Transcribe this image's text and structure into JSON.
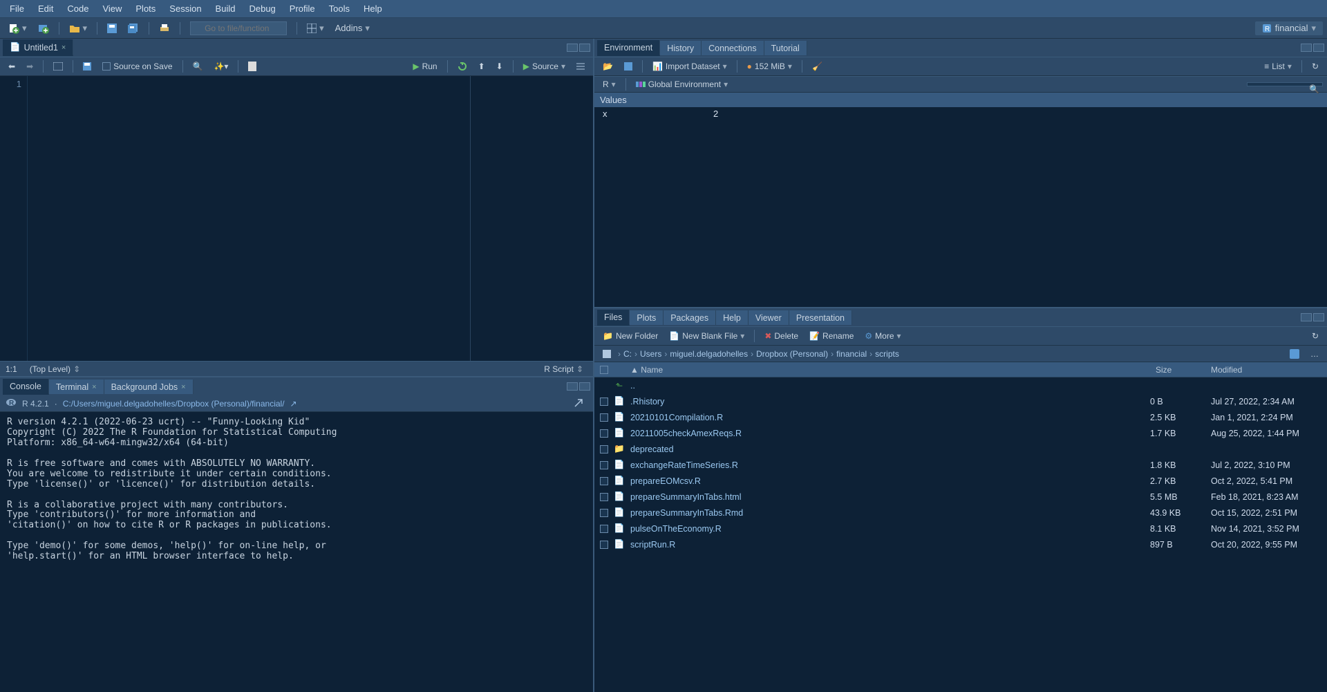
{
  "menu": [
    "File",
    "Edit",
    "Code",
    "View",
    "Plots",
    "Session",
    "Build",
    "Debug",
    "Profile",
    "Tools",
    "Help"
  ],
  "toolbar": {
    "goto_placeholder": "Go to file/function",
    "addins": "Addins",
    "project": "financial"
  },
  "source": {
    "tab": "Untitled1",
    "source_on_save": "Source on Save",
    "run": "Run",
    "source_btn": "Source",
    "line1": "1",
    "status_pos": "1:1",
    "status_scope": "(Top Level)",
    "status_lang": "R Script"
  },
  "console": {
    "tabs": [
      "Console",
      "Terminal",
      "Background Jobs"
    ],
    "r_version": "R 4.2.1",
    "wd": "C:/Users/miguel.delgadohelles/Dropbox (Personal)/financial/",
    "text": "R version 4.2.1 (2022-06-23 ucrt) -- \"Funny-Looking Kid\"\nCopyright (C) 2022 The R Foundation for Statistical Computing\nPlatform: x86_64-w64-mingw32/x64 (64-bit)\n\nR is free software and comes with ABSOLUTELY NO WARRANTY.\nYou are welcome to redistribute it under certain conditions.\nType 'license()' or 'licence()' for distribution details.\n\nR is a collaborative project with many contributors.\nType 'contributors()' for more information and\n'citation()' on how to cite R or R packages in publications.\n\nType 'demo()' for some demos, 'help()' for on-line help, or\n'help.start()' for an HTML browser interface to help."
  },
  "env": {
    "tabs": [
      "Environment",
      "History",
      "Connections",
      "Tutorial"
    ],
    "import": "Import Dataset",
    "mem": "152 MiB",
    "list": "List",
    "scope_lang": "R",
    "scope": "Global Environment",
    "section": "Values",
    "var_name": "x",
    "var_val": "2"
  },
  "files": {
    "tabs": [
      "Files",
      "Plots",
      "Packages",
      "Help",
      "Viewer",
      "Presentation"
    ],
    "new_folder": "New Folder",
    "new_file": "New Blank File",
    "delete": "Delete",
    "rename": "Rename",
    "more": "More",
    "crumbs": [
      "C:",
      "Users",
      "miguel.delgadohelles",
      "Dropbox (Personal)",
      "financial",
      "scripts"
    ],
    "col_name": "Name",
    "col_size": "Size",
    "col_mod": "Modified",
    "up": "..",
    "rows": [
      {
        "icon": "📄",
        "name": ".Rhistory",
        "size": "0 B",
        "mod": "Jul 27, 2022, 2:34 AM"
      },
      {
        "icon": "📄",
        "name": "20210101Compilation.R",
        "size": "2.5 KB",
        "mod": "Jan 1, 2021, 2:24 PM"
      },
      {
        "icon": "📄",
        "name": "20211005checkAmexReqs.R",
        "size": "1.7 KB",
        "mod": "Aug 25, 2022, 1:44 PM"
      },
      {
        "icon": "📁",
        "name": "deprecated",
        "size": "",
        "mod": ""
      },
      {
        "icon": "📄",
        "name": "exchangeRateTimeSeries.R",
        "size": "1.8 KB",
        "mod": "Jul 2, 2022, 3:10 PM"
      },
      {
        "icon": "📄",
        "name": "prepareEOMcsv.R",
        "size": "2.7 KB",
        "mod": "Oct 2, 2022, 5:41 PM"
      },
      {
        "icon": "📄",
        "name": "prepareSummaryInTabs.html",
        "size": "5.5 MB",
        "mod": "Feb 18, 2021, 8:23 AM"
      },
      {
        "icon": "📄",
        "name": "prepareSummaryInTabs.Rmd",
        "size": "43.9 KB",
        "mod": "Oct 15, 2022, 2:51 PM"
      },
      {
        "icon": "📄",
        "name": "pulseOnTheEconomy.R",
        "size": "8.1 KB",
        "mod": "Nov 14, 2021, 3:52 PM"
      },
      {
        "icon": "📄",
        "name": "scriptRun.R",
        "size": "897 B",
        "mod": "Oct 20, 2022, 9:55 PM"
      }
    ]
  }
}
